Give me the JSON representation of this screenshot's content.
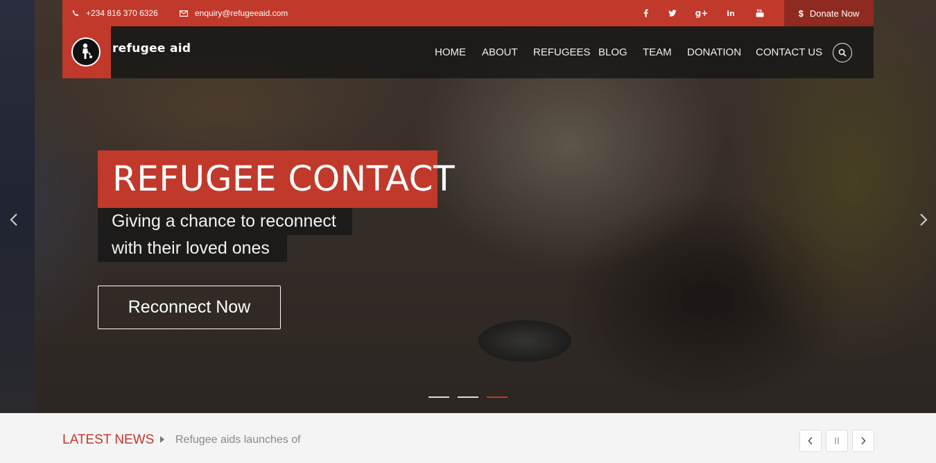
{
  "topbar": {
    "phone": "+234 816 370 6326",
    "email": "enquiry@refugeeaid.com",
    "social": [
      "facebook-icon",
      "twitter-icon",
      "google-plus-icon",
      "linkedin-icon",
      "youtube-icon"
    ],
    "donate_label": "Donate Now"
  },
  "brand": {
    "name": "refugee aid"
  },
  "nav": {
    "items": [
      "HOME",
      "ABOUT",
      "REFUGEES",
      "BLOG",
      "TEAM",
      "DONATION",
      "CONTACT US"
    ]
  },
  "hero": {
    "title": "REFUGEE CONTACT",
    "subtitle_line1": "Giving a chance to reconnect",
    "subtitle_line2": "with their loved ones",
    "cta_label": "Reconnect Now",
    "slide_count": 3,
    "active_slide": 3
  },
  "news": {
    "label": "LATEST NEWS",
    "headline": "Refugee aids launches of"
  },
  "colors": {
    "accent": "#c0392b",
    "accent_dark": "#8e2a20",
    "nav_bg": "#141414"
  }
}
